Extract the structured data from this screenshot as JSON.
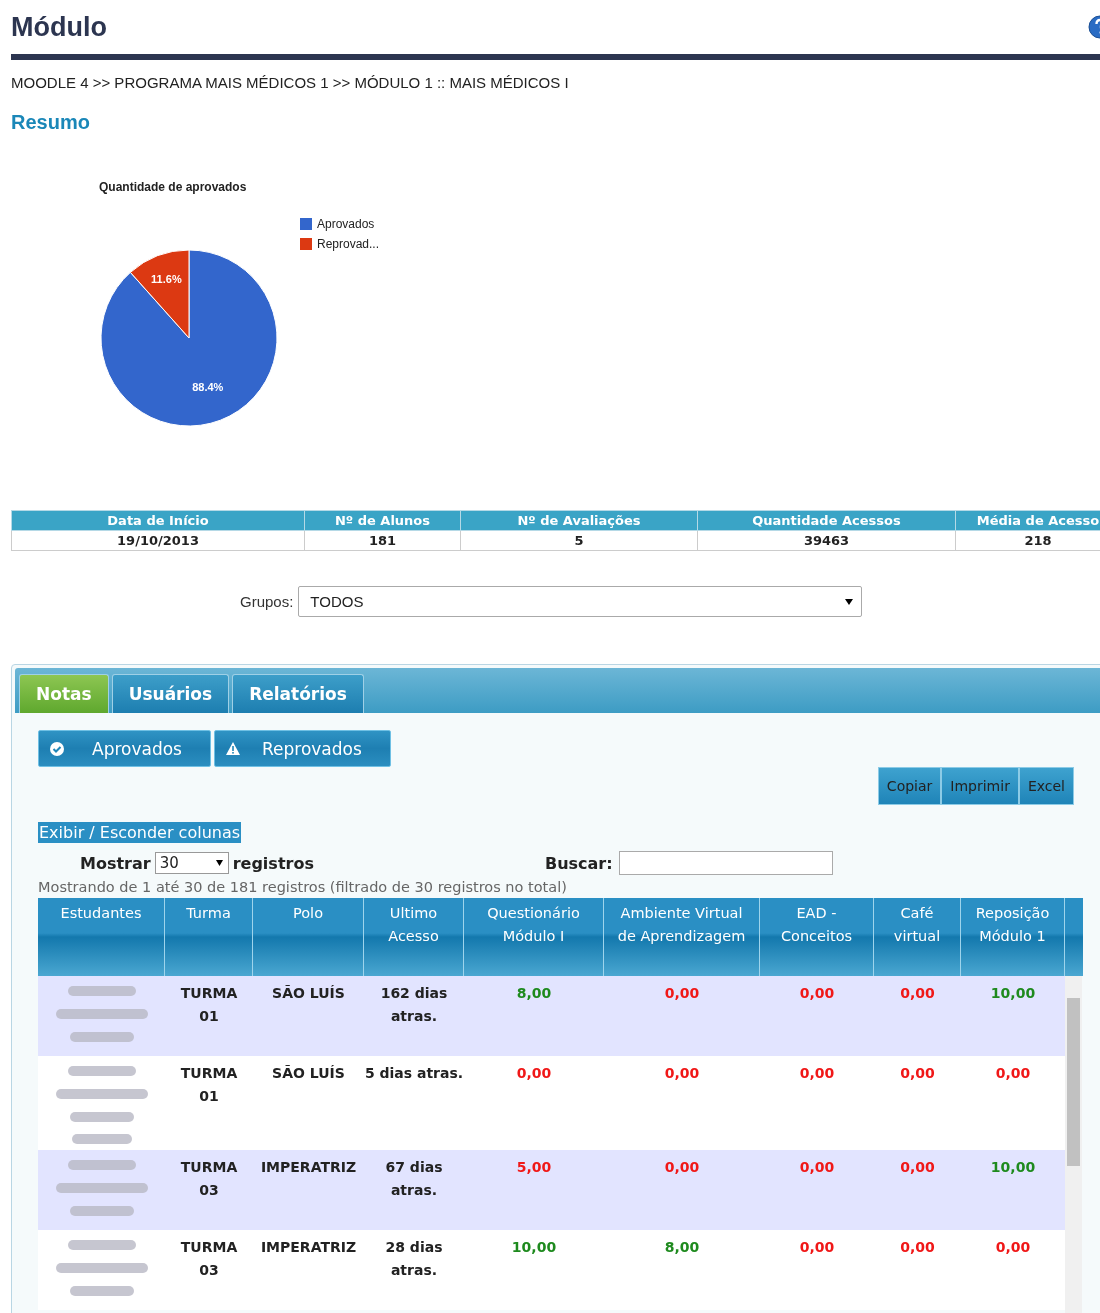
{
  "page": {
    "title": "Módulo",
    "breadcrumb": "MOODLE 4 >> PROGRAMA MAIS MÉDICOS 1 >> MÓDULO 1 :: MAIS MÉDICOS I",
    "section_title": "Resumo"
  },
  "chart": {
    "chart_data": {
      "type": "pie",
      "title": "Quantidade de aprovados",
      "categories": [
        "Aprovados",
        "Reprovad..."
      ],
      "values": [
        88.4,
        11.6
      ],
      "legend": "right",
      "colors": [
        "#3366cc",
        "#dc3912"
      ],
      "value_labels": [
        "88.4%",
        "11.6%"
      ]
    }
  },
  "summary": {
    "columns": [
      "Data de Início",
      "Nº de Alunos",
      "Nº de Avaliações",
      "Quantidade Acessos",
      "Média de Acesso"
    ],
    "values": [
      "19/10/2013",
      "181",
      "5",
      "39463",
      "218"
    ]
  },
  "groups": {
    "label": "Grupos:",
    "value": "TODOS"
  },
  "tabs": [
    {
      "label": "Notas",
      "selected": true
    },
    {
      "label": "Usuários",
      "selected": false
    },
    {
      "label": "Relatórios",
      "selected": false
    }
  ],
  "filters": [
    {
      "label": "Aprovados",
      "kind": "check"
    },
    {
      "label": "Reprovados",
      "kind": "warning"
    }
  ],
  "export_buttons": [
    "Copiar",
    "Imprimir",
    "Excel"
  ],
  "toggle_columns": "Exibir / Esconder colunas",
  "length": {
    "before": "Mostrar",
    "value": "30",
    "after": "registros"
  },
  "search": {
    "label": "Buscar:"
  },
  "info": "Mostrando de 1 até 30 de 181 registros (filtrado de 30 registros no total)",
  "table": {
    "columns": [
      "Estudantes",
      "Turma",
      "Polo",
      "Ultimo Acesso",
      "Questionário Módulo I",
      "Ambiente Virtual de Aprendizagem",
      "EAD - Conceitos",
      "Café virtual",
      "Reposição Módulo 1"
    ],
    "rows": [
      {
        "student": {
          "kind": "redacted"
        },
        "turma": "TURMA 01",
        "polo": "SÃO LUÍS",
        "last_access": "162 dias atras.",
        "grades": [
          {
            "value": "8,00",
            "passed": true
          },
          {
            "value": "0,00",
            "passed": false
          },
          {
            "value": "0,00",
            "passed": false
          },
          {
            "value": "0,00",
            "passed": false
          },
          {
            "value": "10,00",
            "passed": true
          }
        ]
      },
      {
        "student": {
          "kind": "redacted"
        },
        "turma": "TURMA 01",
        "polo": "SÃO LUÍS",
        "last_access": "5 dias atras.",
        "grades": [
          {
            "value": "0,00",
            "passed": false
          },
          {
            "value": "0,00",
            "passed": false
          },
          {
            "value": "0,00",
            "passed": false
          },
          {
            "value": "0,00",
            "passed": false
          },
          {
            "value": "0,00",
            "passed": false
          }
        ]
      },
      {
        "student": {
          "kind": "redacted"
        },
        "turma": "TURMA 03",
        "polo": "IMPERATRIZ",
        "last_access": "67 dias atras.",
        "grades": [
          {
            "value": "5,00",
            "passed": false
          },
          {
            "value": "0,00",
            "passed": false
          },
          {
            "value": "0,00",
            "passed": false
          },
          {
            "value": "0,00",
            "passed": false
          },
          {
            "value": "10,00",
            "passed": true
          }
        ]
      },
      {
        "student": {
          "kind": "redacted"
        },
        "turma": "TURMA 03",
        "polo": "IMPERATRIZ",
        "last_access": "28 dias atras.",
        "grades": [
          {
            "value": "10,00",
            "passed": true
          },
          {
            "value": "8,00",
            "passed": true
          },
          {
            "value": "0,00",
            "passed": false
          },
          {
            "value": "0,00",
            "passed": false
          },
          {
            "value": "0,00",
            "passed": false
          }
        ]
      }
    ]
  }
}
